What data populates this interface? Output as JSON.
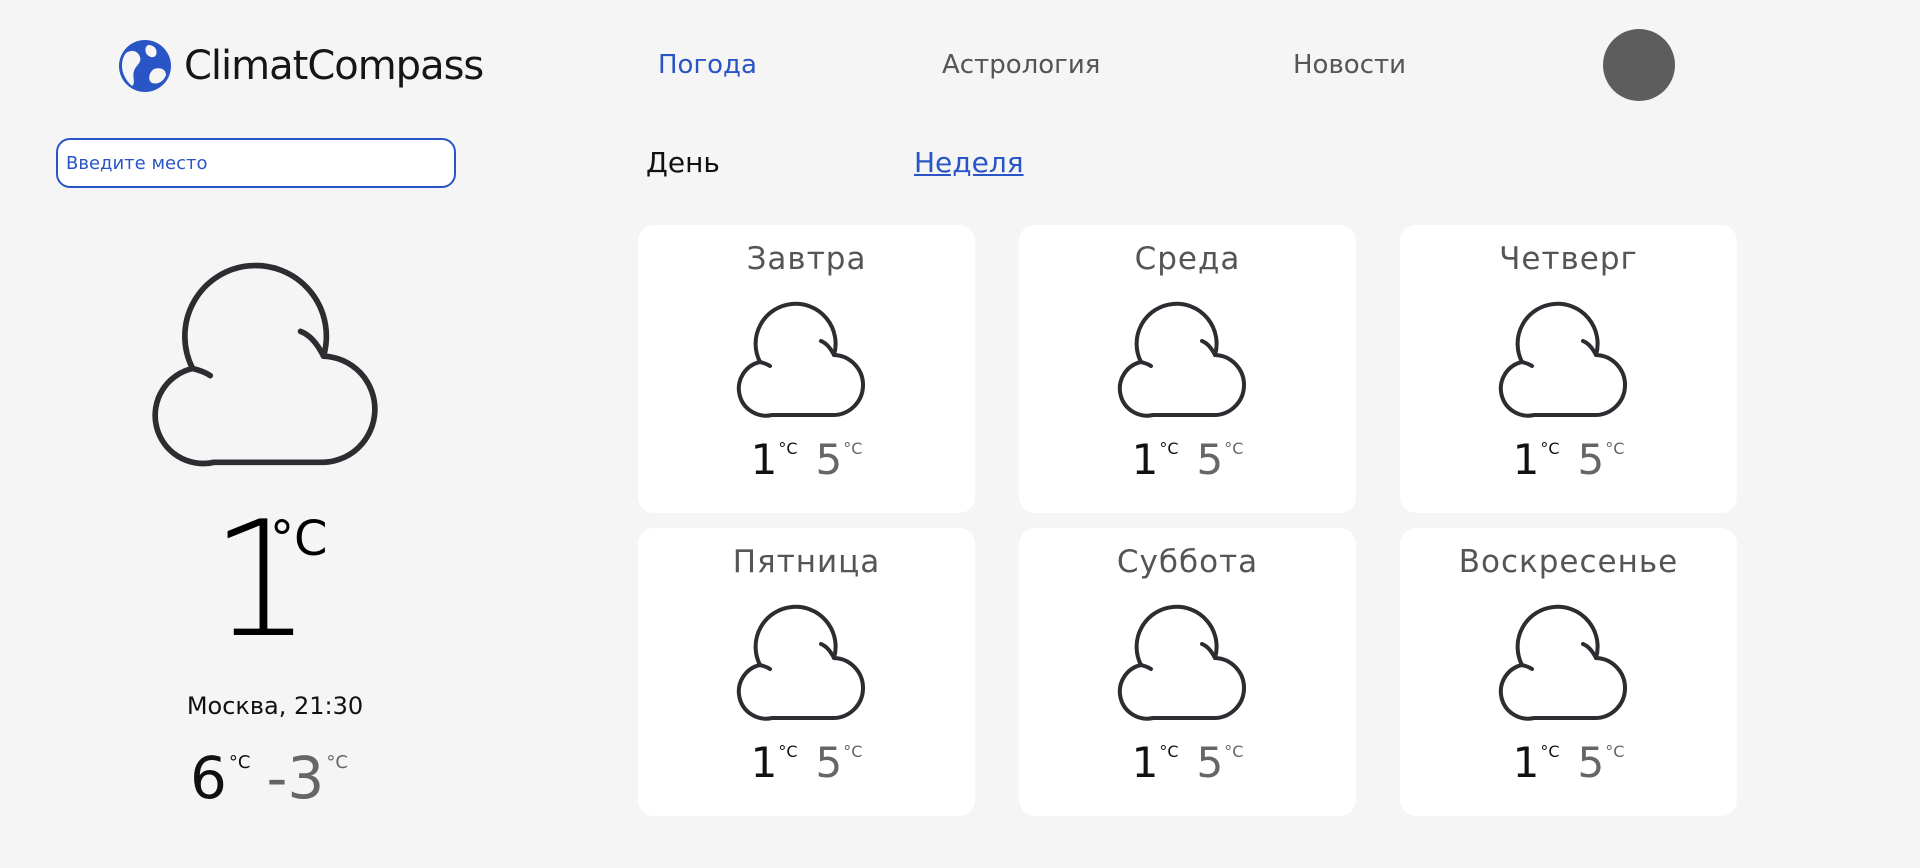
{
  "brand": {
    "name": "ClimatCompass",
    "icon": "globe-icon",
    "accent_color": "#2a55c6"
  },
  "nav": {
    "items": [
      {
        "label": "Погода",
        "active": true
      },
      {
        "label": "Астрология",
        "active": false
      },
      {
        "label": "Новости",
        "active": false
      }
    ]
  },
  "search": {
    "placeholder": "Введите место",
    "value": ""
  },
  "period_tabs": {
    "day_label": "День",
    "week_label": "Неделя",
    "selected": "Неделя"
  },
  "current": {
    "icon": "cloud-icon",
    "temperature": "1",
    "unit": "°C",
    "location_time": "Москва, 21:30",
    "high": "6",
    "low": "-3"
  },
  "week": {
    "days": [
      {
        "name": "Завтра",
        "icon": "cloud-icon",
        "min": "1",
        "max": "5"
      },
      {
        "name": "Среда",
        "icon": "cloud-icon",
        "min": "1",
        "max": "5"
      },
      {
        "name": "Четверг",
        "icon": "cloud-icon",
        "min": "1",
        "max": "5"
      },
      {
        "name": "Пятница",
        "icon": "cloud-icon",
        "min": "1",
        "max": "5"
      },
      {
        "name": "Суббота",
        "icon": "cloud-icon",
        "min": "1",
        "max": "5"
      },
      {
        "name": "Воскресенье",
        "icon": "cloud-icon",
        "min": "1",
        "max": "5"
      }
    ]
  }
}
